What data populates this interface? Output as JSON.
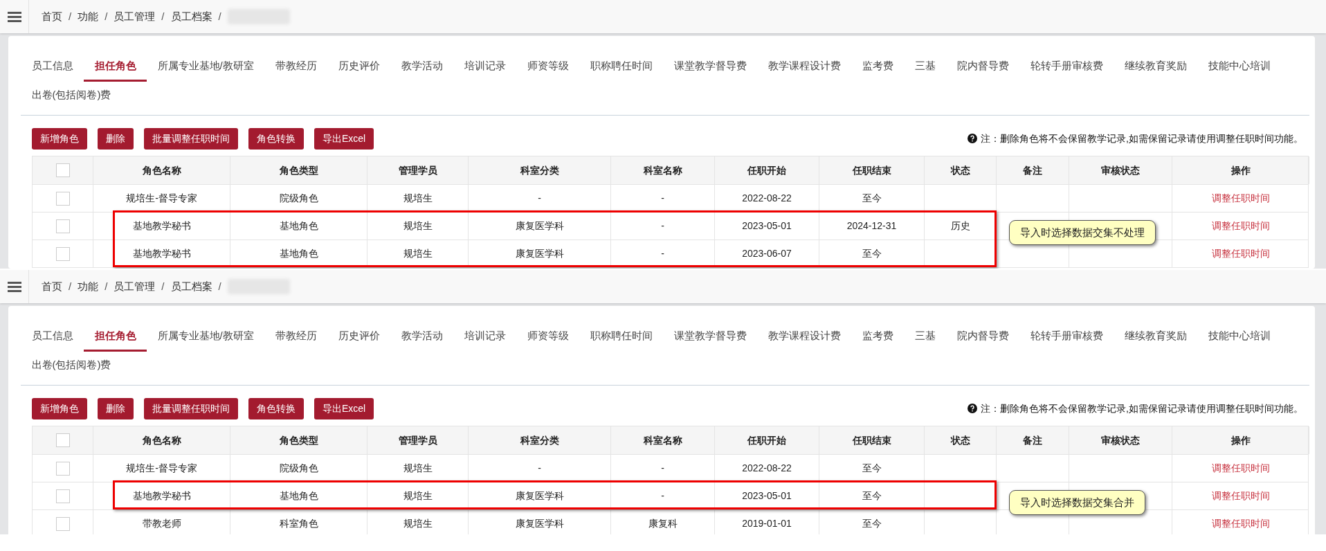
{
  "panels": [
    {
      "breadcrumb": {
        "items": [
          "首页",
          "功能",
          "员工管理",
          "员工档案"
        ],
        "separator": "/"
      },
      "tabs": [
        {
          "label": "员工信息",
          "selected": false
        },
        {
          "label": "担任角色",
          "selected": true
        },
        {
          "label": "所属专业基地/教研室",
          "selected": false
        },
        {
          "label": "带教经历",
          "selected": false
        },
        {
          "label": "历史评价",
          "selected": false
        },
        {
          "label": "教学活动",
          "selected": false
        },
        {
          "label": "培训记录",
          "selected": false
        },
        {
          "label": "师资等级",
          "selected": false
        },
        {
          "label": "职称聘任时间",
          "selected": false
        },
        {
          "label": "课堂教学督导费",
          "selected": false
        },
        {
          "label": "教学课程设计费",
          "selected": false
        },
        {
          "label": "监考费",
          "selected": false
        },
        {
          "label": "三基",
          "selected": false
        },
        {
          "label": "院内督导费",
          "selected": false
        },
        {
          "label": "轮转手册审核费",
          "selected": false
        },
        {
          "label": "继续教育奖励",
          "selected": false
        },
        {
          "label": "技能中心培训",
          "selected": false
        },
        {
          "label": "出卷(包括阅卷)费",
          "selected": false
        }
      ],
      "buttons": [
        "新增角色",
        "删除",
        "批量调整任职时间",
        "角色转换",
        "导出Excel"
      ],
      "note": "注：删除角色将不会保留教学记录,如需保留记录请使用调整任职时间功能。",
      "table": {
        "header_checked": false,
        "columns": [
          "角色名称",
          "角色类型",
          "管理学员",
          "科室分类",
          "科室名称",
          "任职开始",
          "任职结束",
          "状态",
          "备注",
          "审核状态",
          "操作"
        ],
        "rows": [
          {
            "checked": false,
            "highlighted": false,
            "role_name": "规培生-督导专家",
            "role_type": "院级角色",
            "students": "规培生",
            "dept_category": "-",
            "dept_name": "-",
            "start": "2022-08-22",
            "end": "至今",
            "action": "调整任职时间"
          },
          {
            "checked": false,
            "highlighted": true,
            "role_name": "基地教学秘书",
            "role_type": "基地角色",
            "students": "规培生",
            "dept_category": "康复医学科",
            "dept_name": "-",
            "start": "2023-05-01",
            "end": "2024-12-31",
            "status": "历史",
            "action": "调整任职时间"
          },
          {
            "checked": false,
            "highlighted": true,
            "role_name": "基地教学秘书",
            "role_type": "基地角色",
            "students": "规培生",
            "dept_category": "康复医学科",
            "dept_name": "-",
            "start": "2023-06-07",
            "end": "至今",
            "action": "调整任职时间"
          }
        ]
      },
      "callout": "导入时选择数据交集不处理"
    },
    {
      "breadcrumb": {
        "items": [
          "首页",
          "功能",
          "员工管理",
          "员工档案"
        ],
        "separator": "/"
      },
      "tabs": [
        {
          "label": "员工信息",
          "selected": false
        },
        {
          "label": "担任角色",
          "selected": true
        },
        {
          "label": "所属专业基地/教研室",
          "selected": false
        },
        {
          "label": "带教经历",
          "selected": false
        },
        {
          "label": "历史评价",
          "selected": false
        },
        {
          "label": "教学活动",
          "selected": false
        },
        {
          "label": "培训记录",
          "selected": false
        },
        {
          "label": "师资等级",
          "selected": false
        },
        {
          "label": "职称聘任时间",
          "selected": false
        },
        {
          "label": "课堂教学督导费",
          "selected": false
        },
        {
          "label": "教学课程设计费",
          "selected": false
        },
        {
          "label": "监考费",
          "selected": false
        },
        {
          "label": "三基",
          "selected": false
        },
        {
          "label": "院内督导费",
          "selected": false
        },
        {
          "label": "轮转手册审核费",
          "selected": false
        },
        {
          "label": "继续教育奖励",
          "selected": false
        },
        {
          "label": "技能中心培训",
          "selected": false
        },
        {
          "label": "出卷(包括阅卷)费",
          "selected": false
        }
      ],
      "buttons": [
        "新增角色",
        "删除",
        "批量调整任职时间",
        "角色转换",
        "导出Excel"
      ],
      "note": "注：删除角色将不会保留教学记录,如需保留记录请使用调整任职时间功能。",
      "table": {
        "header_checked": false,
        "columns": [
          "角色名称",
          "角色类型",
          "管理学员",
          "科室分类",
          "科室名称",
          "任职开始",
          "任职结束",
          "状态",
          "备注",
          "审核状态",
          "操作"
        ],
        "rows": [
          {
            "checked": false,
            "highlighted": false,
            "role_name": "规培生-督导专家",
            "role_type": "院级角色",
            "students": "规培生",
            "dept_category": "-",
            "dept_name": "-",
            "start": "2022-08-22",
            "end": "至今",
            "action": "调整任职时间"
          },
          {
            "checked": false,
            "highlighted": true,
            "role_name": "基地教学秘书",
            "role_type": "基地角色",
            "students": "规培生",
            "dept_category": "康复医学科",
            "dept_name": "-",
            "start": "2023-05-01",
            "end": "至今",
            "action": "调整任职时间"
          },
          {
            "checked": false,
            "highlighted": false,
            "role_name": "带教老师",
            "role_type": "科室角色",
            "students": "规培生",
            "dept_category": "康复医学科",
            "dept_name": "康复科",
            "start": "2019-01-01",
            "end": "至今",
            "action": "调整任职时间"
          }
        ]
      },
      "callout": "导入时选择数据交集合并"
    }
  ]
}
